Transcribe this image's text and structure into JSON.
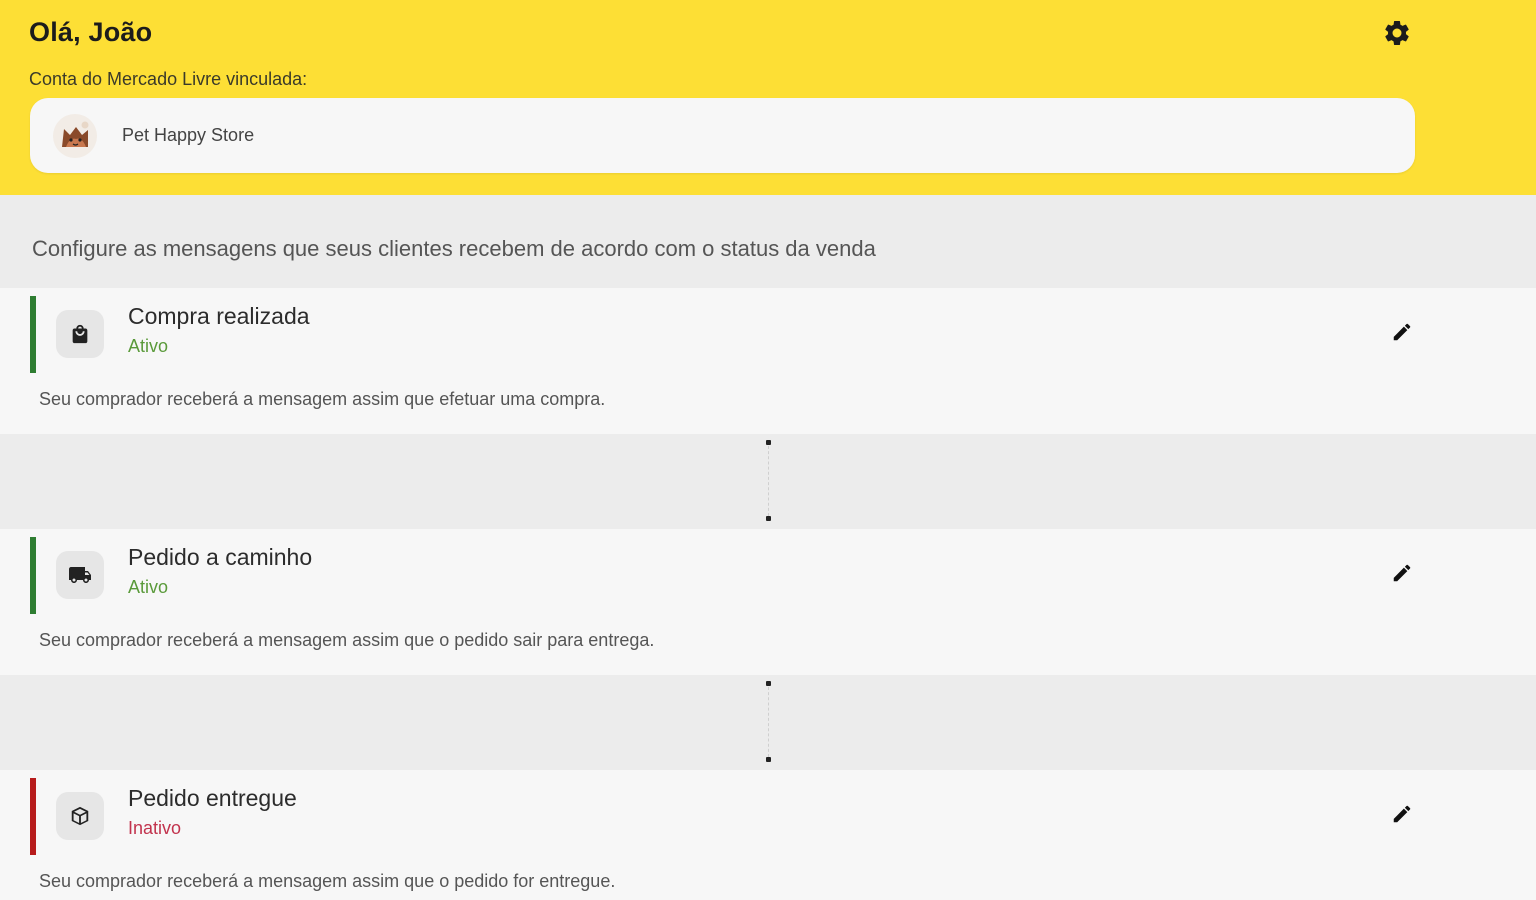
{
  "header": {
    "greeting": "Olá, João",
    "account_label": "Conta do Mercado Livre vinculada:",
    "store_name": "Pet Happy Store",
    "settings_icon": "gear-icon",
    "background_color": "#fddf35"
  },
  "intro": "Configure as mensagens que seus clientes recebem de acordo com o status da venda",
  "status_colors": {
    "active": "#2e7d32",
    "inactive": "#b71c1c",
    "active_text": "#5a9a3a",
    "inactive_text": "#c2334d"
  },
  "messages": [
    {
      "title": "Compra realizada",
      "status": "Ativo",
      "active": true,
      "description": "Seu comprador receberá a mensagem assim que efetuar uma compra.",
      "icon": "shopping-bag-icon"
    },
    {
      "title": "Pedido a caminho",
      "status": "Ativo",
      "active": true,
      "description": "Seu comprador receberá a mensagem assim que o pedido sair para entrega.",
      "icon": "truck-icon"
    },
    {
      "title": "Pedido entregue",
      "status": "Inativo",
      "active": false,
      "description": "Seu comprador receberá a mensagem assim que o pedido for entregue.",
      "icon": "package-icon"
    }
  ]
}
